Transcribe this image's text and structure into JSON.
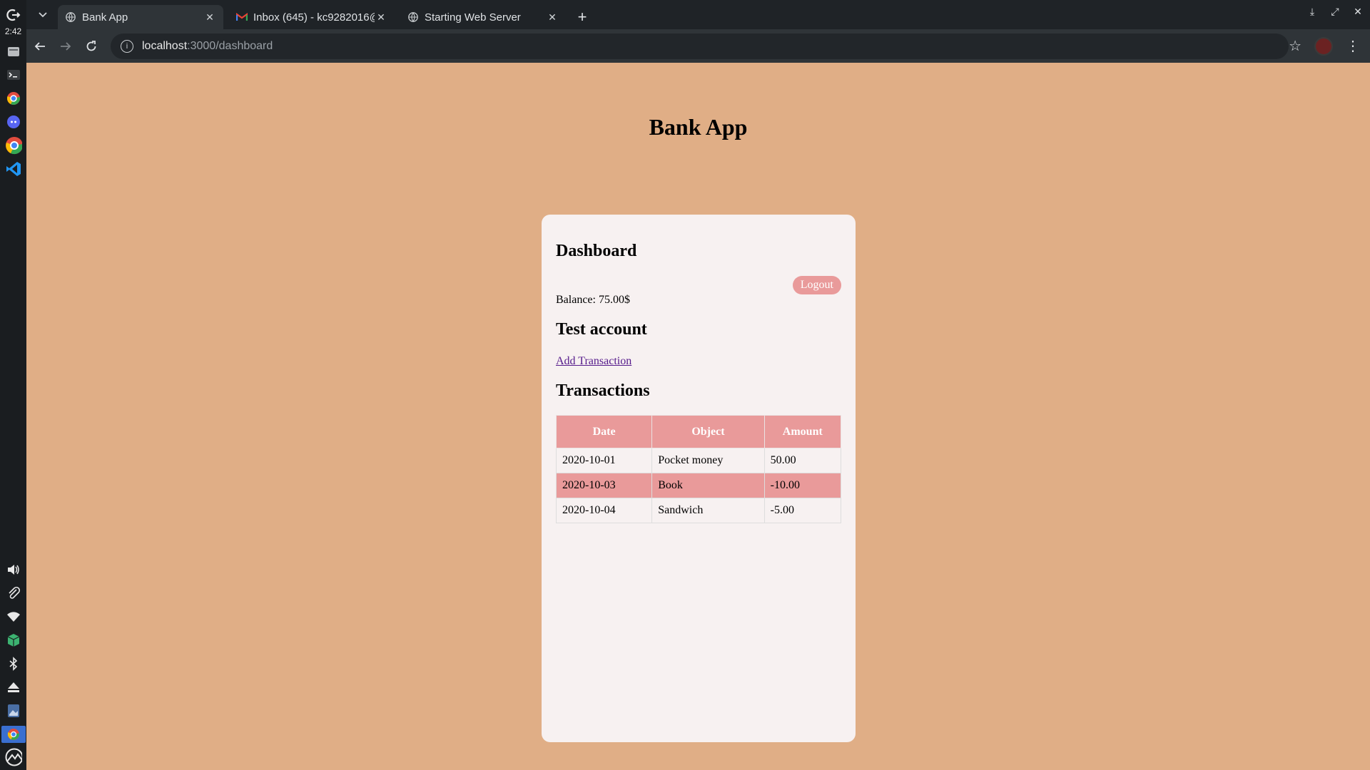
{
  "os": {
    "clock": "2:42"
  },
  "browser": {
    "tabs": [
      {
        "title": "Bank App",
        "active": true,
        "icon": "globe-icon"
      },
      {
        "title": "Inbox (645) - kc9282016@",
        "active": false,
        "icon": "gmail-icon"
      },
      {
        "title": "Starting Web Server",
        "active": false,
        "icon": "globe-icon"
      }
    ],
    "url_host": "localhost",
    "url_path": ":3000/dashboard"
  },
  "page": {
    "app_title": "Bank App",
    "dashboard_title": "Dashboard",
    "logout_label": "Logout",
    "balance_label": "Balance: ",
    "balance_value": "75.00",
    "currency": "$",
    "account_name": "Test account",
    "add_transaction_label": "Add Transaction",
    "transactions_title": "Transactions",
    "table": {
      "headers": [
        "Date",
        "Object",
        "Amount"
      ],
      "rows": [
        [
          "2020-10-01",
          "Pocket money",
          "50.00"
        ],
        [
          "2020-10-03",
          "Book",
          "-10.00"
        ],
        [
          "2020-10-04",
          "Sandwich",
          "-5.00"
        ]
      ]
    }
  },
  "colors": {
    "page_bg": "#e0ae86",
    "card_bg": "#f7f1f1",
    "accent": "#e99a9a"
  }
}
